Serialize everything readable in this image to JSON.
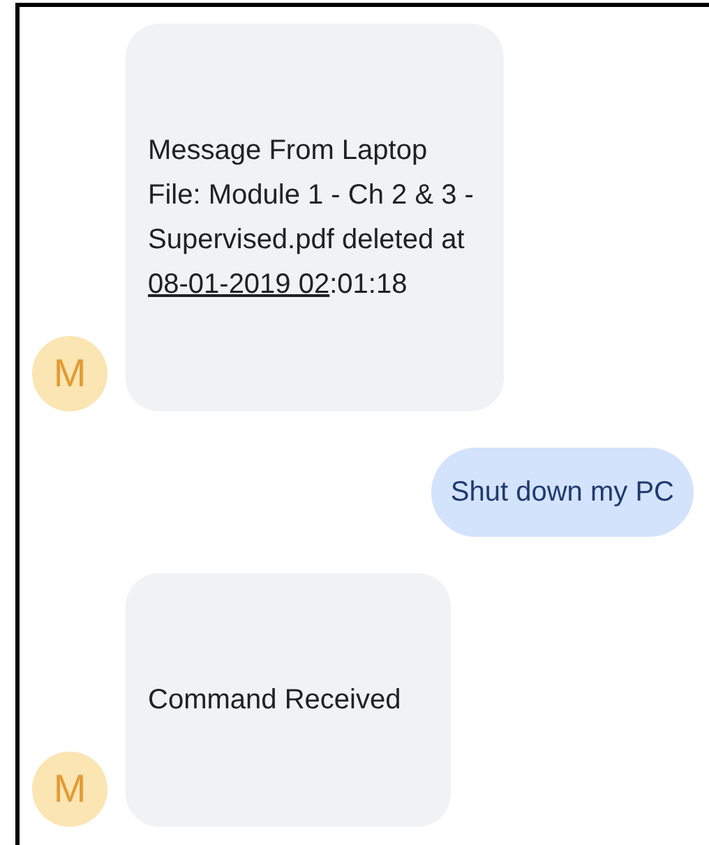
{
  "messages": [
    {
      "kind": "incoming",
      "avatar": "M",
      "segments": [
        {
          "kind": "text",
          "text": "Message From Laptop\nFile: Module 1 - Ch 2 & 3  -\nSupervised.pdf deleted at\n"
        },
        {
          "kind": "link",
          "text": "08-01-2019 02"
        },
        {
          "kind": "text",
          "text": ":01:18"
        }
      ]
    },
    {
      "kind": "outgoing",
      "segments": [
        {
          "kind": "text",
          "text": "Shut down my PC"
        }
      ]
    },
    {
      "kind": "incoming",
      "avatar": "M",
      "segments": [
        {
          "kind": "text",
          "text": "Command Received"
        }
      ]
    }
  ]
}
